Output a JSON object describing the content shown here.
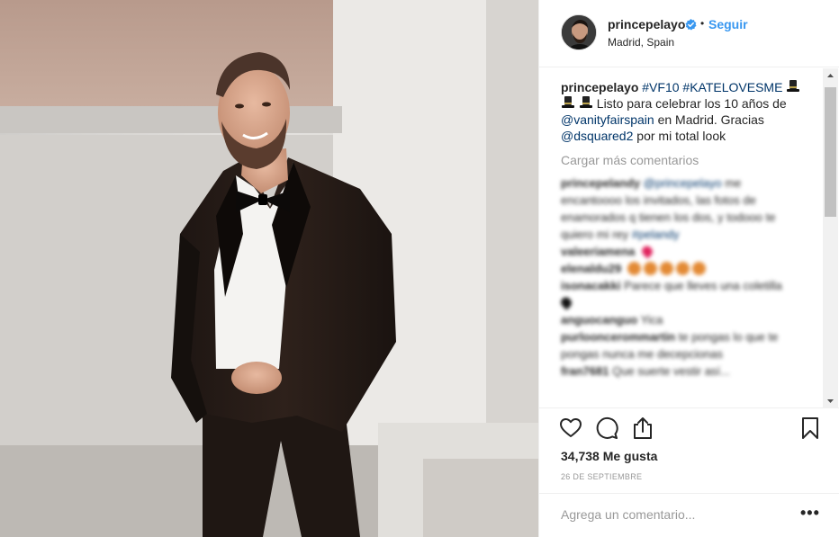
{
  "post": {
    "username": "princepelayo",
    "follow_label": "Seguir",
    "separator": "•",
    "location": "Madrid, Spain",
    "caption": {
      "username": "princepelayo",
      "hashtag1": "#VF10",
      "hashtag2": "#KATELOVESME",
      "text1": "Listo para celebrar los 10 años de",
      "mention1": "@vanityfairspain",
      "text2": "en Madrid. Gracias",
      "mention2": "@dsquared2",
      "text3": "por mi total look"
    },
    "load_more_label": "Cargar más comentarios",
    "comments": [
      {
        "user": "princepelandy",
        "mention": "@princepelayo",
        "text": "me encantoooo los invitados, las fotos de enamorados q tienen los dos, y todooo te quiero mi rey",
        "tag": "#pelandy"
      },
      {
        "user": "valeeriamena",
        "text": ""
      },
      {
        "user": "elenaldu29",
        "text": ""
      },
      {
        "user": "isonacakki",
        "text": "Parece que lleves una coletilla"
      },
      {
        "user": "anguocanguo",
        "text": "Yica"
      },
      {
        "user": "purlooncerommartin",
        "text": "te pongas lo que te pongas nunca me decepcionas"
      },
      {
        "user": "fran7681",
        "text": "Que suerte vestir así..."
      }
    ],
    "likes_label": "34,738 Me gusta",
    "date": "26 DE SEPTIEMBRE",
    "add_comment_placeholder": "Agrega un comentario...",
    "more_label": "•••"
  },
  "icons": {
    "verified": "verified-badge-icon",
    "like": "heart-icon",
    "comment": "comment-bubble-icon",
    "share": "share-upload-icon",
    "save": "bookmark-icon",
    "hat": "top-hat-emoji-icon"
  },
  "colors": {
    "link_blue": "#3897f0",
    "mention_blue": "#003569",
    "muted_gray": "#999999",
    "border": "#efefef"
  }
}
